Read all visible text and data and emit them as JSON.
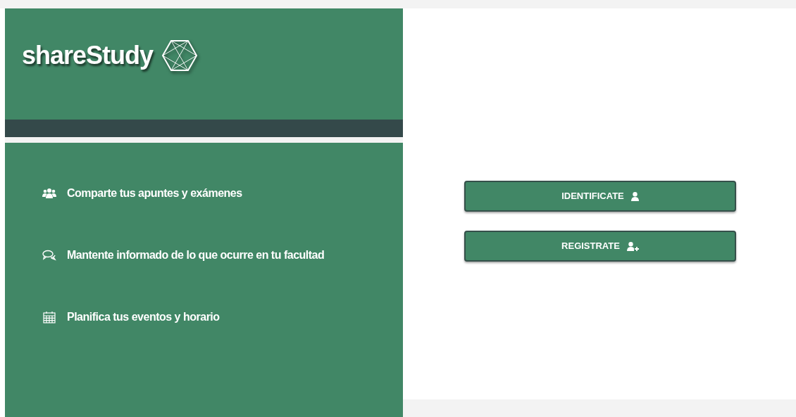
{
  "brand": {
    "title": "shareStudy"
  },
  "features": [
    {
      "kind": "users",
      "text": "Comparte tus apuntes y exámenes"
    },
    {
      "kind": "chat",
      "text": "Mantente informado de lo que ocurre en tu facultad"
    },
    {
      "kind": "calendar",
      "text": "Planifica tus eventos y horario"
    }
  ],
  "buttons": [
    {
      "kind": "user",
      "label": "IDENTIFICATE"
    },
    {
      "kind": "user-plus",
      "label": "REGISTRATE"
    }
  ]
}
